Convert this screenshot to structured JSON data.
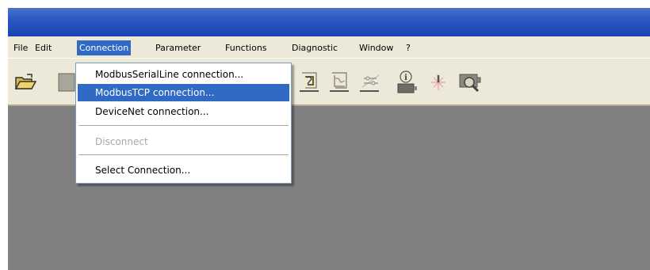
{
  "menu": {
    "items": [
      {
        "label": "File"
      },
      {
        "label": "Edit"
      },
      {
        "label": "Connection"
      },
      {
        "label": "Parameter"
      },
      {
        "label": "Functions"
      },
      {
        "label": "Diagnostic"
      },
      {
        "label": "Window"
      },
      {
        "label": "?"
      }
    ],
    "active_item": "Connection"
  },
  "connection_menu": {
    "items": [
      {
        "label": "ModbusSerialLine connection..."
      },
      {
        "label": "ModbusTCP connection..."
      },
      {
        "label": "DeviceNet connection..."
      },
      {
        "label": "Disconnect",
        "enabled": false
      },
      {
        "label": "Select Connection..."
      }
    ],
    "highlighted": "ModbusTCP connection..."
  },
  "toolbar": {
    "icons": [
      "open-folder-icon",
      "save-icon",
      "upload-icon",
      "chart-icon",
      "switch-icon",
      "device-info-icon",
      "sparkle-icon",
      "inspect-icon"
    ]
  },
  "colors": {
    "title_bar": "#2a58c4",
    "highlight": "#316ac5",
    "client_area": "#808080",
    "chrome": "#ece9d8"
  }
}
